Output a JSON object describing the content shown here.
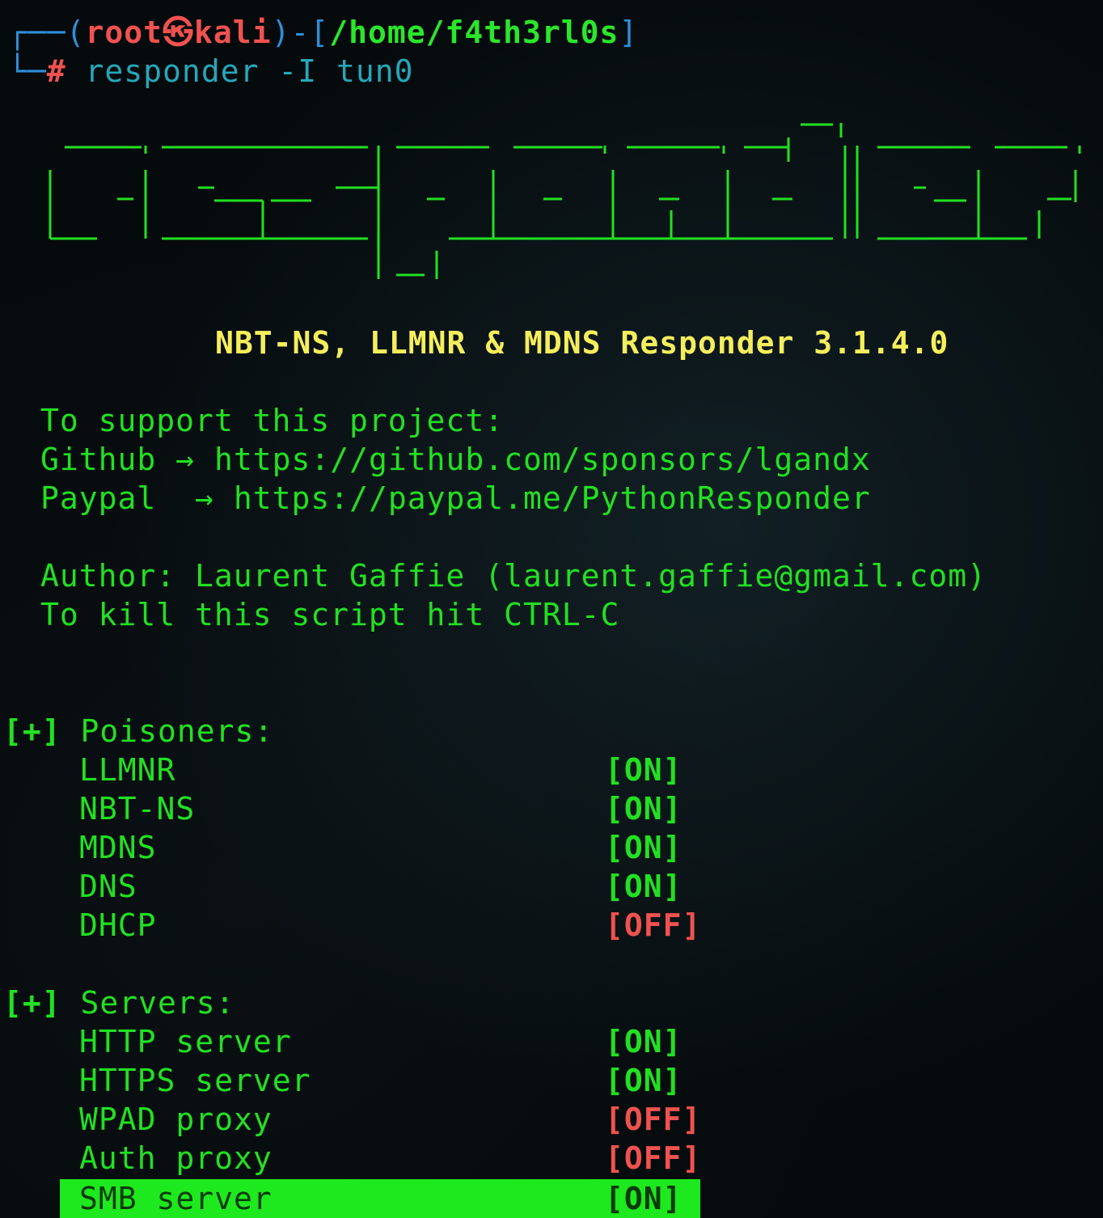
{
  "prompt": {
    "user": "root",
    "skull": "㉿",
    "host": "kali",
    "path": "/home/f4th3rl0s",
    "hash": "#",
    "command": "responder -I tun0"
  },
  "banner_title": "NBT-NS, LLMNR & MDNS Responder 3.1.4.0",
  "support": {
    "line1": "To support this project:",
    "github_label": "Github",
    "arrow": "→",
    "github_url": "https://github.com/sponsors/lgandx",
    "paypal_label": "Paypal",
    "paypal_url": "https://paypal.me/PythonResponder"
  },
  "author": "Author: Laurent Gaffie (laurent.gaffie@gmail.com)",
  "kill_hint": "To kill this script hit CTRL-C",
  "poisoners": {
    "tag": "[+]",
    "heading": "Poisoners:",
    "items": [
      {
        "name": "LLMNR",
        "status": "[ON]"
      },
      {
        "name": "NBT-NS",
        "status": "[ON]"
      },
      {
        "name": "MDNS",
        "status": "[ON]"
      },
      {
        "name": "DNS",
        "status": "[ON]"
      },
      {
        "name": "DHCP",
        "status": "[OFF]"
      }
    ]
  },
  "servers": {
    "tag": "[+]",
    "heading": "Servers:",
    "items": [
      {
        "name": "HTTP server",
        "status": "[ON]"
      },
      {
        "name": "HTTPS server",
        "status": "[ON]"
      },
      {
        "name": "WPAD proxy",
        "status": "[OFF]"
      },
      {
        "name": "Auth proxy",
        "status": "[OFF]"
      },
      {
        "name": "SMB server",
        "status": "[ON]"
      }
    ]
  },
  "colors": {
    "background": "#050a0c",
    "text_green": "#22e022",
    "banner_yellow": "#f5ee5c",
    "off_red": "#f0524f",
    "highlight": "#1ee81e"
  }
}
